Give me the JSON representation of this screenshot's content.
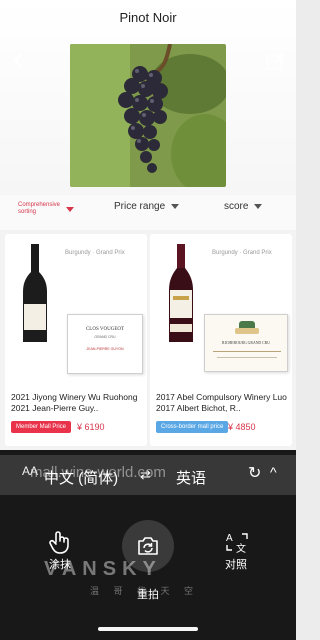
{
  "header": {
    "title": "Pinot Noir"
  },
  "filters": {
    "sort_line1": "Comprehensive",
    "sort_line2": "sorting",
    "price": "Price range",
    "score": "score"
  },
  "products": [
    {
      "region": "Burgundy · Grand Prix",
      "name": "2021 Jiyong Winery Wu Ruohong 2021 Jean-Pierre Guy..",
      "badge": "Member Mall Price",
      "price": "¥ 6190",
      "label_line1": "CLOS VOUGEOT",
      "label_line2": "GRAND CRU",
      "label_line3": "JEAN-PIERRE GUYON",
      "badge_color": "#e8334a"
    },
    {
      "region": "Burgundy · Grand Prix",
      "name": "2017 Abel Compulsory Winery Luo  2017 Albert Bichot, R..",
      "badge": "Cross-border mall price",
      "price": "¥ 4850",
      "label_line1": "RICHEBOURG GRAND CRU",
      "badge_color": "#5aa7e6"
    }
  ],
  "translate_bar": {
    "text_size_icon": "AA",
    "background_text": "mall.wine-world.com",
    "source_lang": "中文 (简体)",
    "swap_icon": "⇄",
    "target_lang": "英语",
    "reload_icon": "↻",
    "expand_icon": "^"
  },
  "tools": {
    "smear": "涂抹",
    "retake": "重拍",
    "compare": "对照"
  },
  "watermark": {
    "main": "VANSKY",
    "sub": "温 哥 华 天 空"
  }
}
